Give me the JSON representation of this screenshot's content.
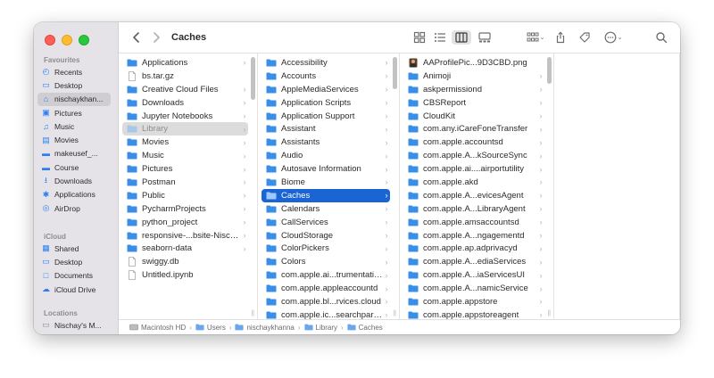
{
  "window": {
    "title": "Caches"
  },
  "sidebar": {
    "favourites_label": "Favourites",
    "favourites": [
      {
        "label": "Recents",
        "icon": "clock-icon"
      },
      {
        "label": "Desktop",
        "icon": "desktop-icon"
      },
      {
        "label": "nischaykhan...",
        "icon": "home-icon",
        "selected": true
      },
      {
        "label": "Pictures",
        "icon": "pictures-icon"
      },
      {
        "label": "Music",
        "icon": "music-icon"
      },
      {
        "label": "Movies",
        "icon": "movies-icon"
      },
      {
        "label": "makeusef_...",
        "icon": "folder-icon"
      },
      {
        "label": "Course",
        "icon": "folder-icon"
      },
      {
        "label": "Downloads",
        "icon": "downloads-icon"
      },
      {
        "label": "Applications",
        "icon": "applications-icon"
      },
      {
        "label": "AirDrop",
        "icon": "airdrop-icon"
      }
    ],
    "icloud_label": "iCloud",
    "icloud": [
      {
        "label": "Shared",
        "icon": "shared-icon"
      },
      {
        "label": "Desktop",
        "icon": "desktop-icon"
      },
      {
        "label": "Documents",
        "icon": "document-icon"
      },
      {
        "label": "iCloud Drive",
        "icon": "cloud-icon"
      }
    ],
    "locations_label": "Locations",
    "locations": [
      {
        "label": "Nischay's M...",
        "icon": "laptop-icon"
      }
    ]
  },
  "columns": {
    "col1": [
      {
        "label": "Applications",
        "type": "folder",
        "chevron": true
      },
      {
        "label": "bs.tar.gz",
        "type": "file",
        "chevron": false
      },
      {
        "label": "Creative Cloud Files",
        "type": "folder",
        "chevron": true
      },
      {
        "label": "Downloads",
        "type": "folder",
        "chevron": true
      },
      {
        "label": "Jupyter Notebooks",
        "type": "folder",
        "chevron": true
      },
      {
        "label": "Library",
        "type": "folder",
        "chevron": true,
        "state": "soft"
      },
      {
        "label": "Movies",
        "type": "folder",
        "chevron": true
      },
      {
        "label": "Music",
        "type": "folder",
        "chevron": true
      },
      {
        "label": "Pictures",
        "type": "folder",
        "chevron": true
      },
      {
        "label": "Postman",
        "type": "folder",
        "chevron": true
      },
      {
        "label": "Public",
        "type": "folder",
        "chevron": true
      },
      {
        "label": "PycharmProjects",
        "type": "folder",
        "chevron": true
      },
      {
        "label": "python_project",
        "type": "folder",
        "chevron": true
      },
      {
        "label": "responsive-...bsite-Nischay",
        "type": "folder",
        "chevron": true
      },
      {
        "label": "seaborn-data",
        "type": "folder",
        "chevron": true
      },
      {
        "label": "swiggy.db",
        "type": "file",
        "chevron": false
      },
      {
        "label": "Untitled.ipynb",
        "type": "file",
        "chevron": false
      }
    ],
    "col2": [
      {
        "label": "Accessibility",
        "type": "folder",
        "chevron": true
      },
      {
        "label": "Accounts",
        "type": "folder",
        "chevron": true
      },
      {
        "label": "AppleMediaServices",
        "type": "folder",
        "chevron": true
      },
      {
        "label": "Application Scripts",
        "type": "folder",
        "chevron": true
      },
      {
        "label": "Application Support",
        "type": "folder",
        "chevron": true
      },
      {
        "label": "Assistant",
        "type": "folder",
        "chevron": true
      },
      {
        "label": "Assistants",
        "type": "folder",
        "chevron": true
      },
      {
        "label": "Audio",
        "type": "folder",
        "chevron": true
      },
      {
        "label": "Autosave Information",
        "type": "folder",
        "chevron": true
      },
      {
        "label": "Biome",
        "type": "folder",
        "chevron": true
      },
      {
        "label": "Caches",
        "type": "folder",
        "chevron": true,
        "state": "sel"
      },
      {
        "label": "Calendars",
        "type": "folder",
        "chevron": true
      },
      {
        "label": "CallServices",
        "type": "folder",
        "chevron": true
      },
      {
        "label": "CloudStorage",
        "type": "folder",
        "chevron": true
      },
      {
        "label": "ColorPickers",
        "type": "folder",
        "chevron": true
      },
      {
        "label": "Colors",
        "type": "folder",
        "chevron": true
      },
      {
        "label": "com.apple.ai...trumentation",
        "type": "folder",
        "chevron": true
      },
      {
        "label": "com.apple.appleaccountd",
        "type": "folder",
        "chevron": true
      },
      {
        "label": "com.apple.bl...rvices.cloud",
        "type": "folder",
        "chevron": true
      },
      {
        "label": "com.apple.ic...searchpartyd",
        "type": "folder",
        "chevron": true
      }
    ],
    "col3": [
      {
        "label": "AAProfilePic...9D3CBD.png",
        "type": "image",
        "chevron": false
      },
      {
        "label": "Animoji",
        "type": "folder",
        "chevron": true
      },
      {
        "label": "askpermissiond",
        "type": "folder",
        "chevron": true
      },
      {
        "label": "CBSReport",
        "type": "folder",
        "chevron": true
      },
      {
        "label": "CloudKit",
        "type": "folder",
        "chevron": true
      },
      {
        "label": "com.any.iCareFoneTransfer",
        "type": "folder",
        "chevron": true
      },
      {
        "label": "com.apple.accountsd",
        "type": "folder",
        "chevron": true
      },
      {
        "label": "com.apple.A...kSourceSync",
        "type": "folder",
        "chevron": true
      },
      {
        "label": "com.apple.ai....airportutility",
        "type": "folder",
        "chevron": true
      },
      {
        "label": "com.apple.akd",
        "type": "folder",
        "chevron": true
      },
      {
        "label": "com.apple.A...evicesAgent",
        "type": "folder",
        "chevron": true
      },
      {
        "label": "com.apple.A...LibraryAgent",
        "type": "folder",
        "chevron": true
      },
      {
        "label": "com.apple.amsaccountsd",
        "type": "folder",
        "chevron": true
      },
      {
        "label": "com.apple.A...ngagementd",
        "type": "folder",
        "chevron": true
      },
      {
        "label": "com.apple.ap.adprivacyd",
        "type": "folder",
        "chevron": true
      },
      {
        "label": "com.apple.A...ediaServices",
        "type": "folder",
        "chevron": true
      },
      {
        "label": "com.apple.A...iaServicesUI",
        "type": "folder",
        "chevron": true
      },
      {
        "label": "com.apple.A...namicService",
        "type": "folder",
        "chevron": true
      },
      {
        "label": "com.apple.appstore",
        "type": "folder",
        "chevron": true
      },
      {
        "label": "com.apple.appstoreagent",
        "type": "folder",
        "chevron": true
      }
    ]
  },
  "pathbar": [
    {
      "label": "Macintosh HD",
      "icon": "disk-icon"
    },
    {
      "label": "Users",
      "icon": "folder-icon"
    },
    {
      "label": "nischaykhanna",
      "icon": "home-icon"
    },
    {
      "label": "Library",
      "icon": "folder-icon"
    },
    {
      "label": "Caches",
      "icon": "folder-icon"
    }
  ],
  "colors": {
    "accent": "#1a64d3",
    "folder": "#3a8ee6",
    "sidebar_bg": "#e6e3e8"
  }
}
